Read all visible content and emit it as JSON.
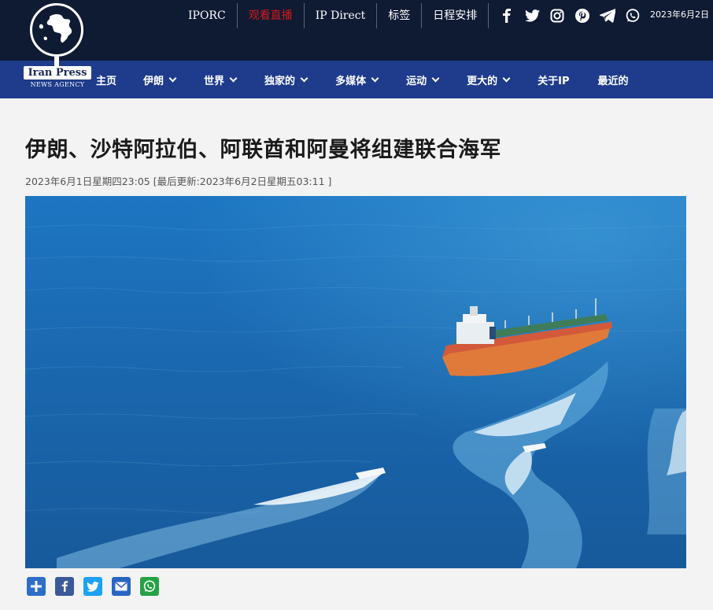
{
  "brand": {
    "name": "Iran Press",
    "subtitle": "NEWS AGENCY"
  },
  "top_links": [
    {
      "label": "IPORC"
    },
    {
      "label": "观看直播"
    },
    {
      "label": "IP Direct"
    },
    {
      "label": "标签"
    },
    {
      "label": "日程安排"
    }
  ],
  "social_icons": [
    "facebook-icon",
    "twitter-icon",
    "instagram-icon",
    "pinterest-icon",
    "telegram-icon",
    "whatsapp-icon"
  ],
  "top_date": "2023年6月2日",
  "nav": [
    {
      "label": "主页",
      "dropdown": false
    },
    {
      "label": "伊朗",
      "dropdown": true
    },
    {
      "label": "世界",
      "dropdown": true
    },
    {
      "label": "独家的",
      "dropdown": true
    },
    {
      "label": "多媒体",
      "dropdown": true
    },
    {
      "label": "运动",
      "dropdown": true
    },
    {
      "label": "更大的",
      "dropdown": true
    },
    {
      "label": "关于IP",
      "dropdown": false
    },
    {
      "label": "最近的",
      "dropdown": false
    }
  ],
  "article": {
    "title": "伊朗、沙特阿拉伯、阿联酋和阿曼将组建联合海军",
    "meta": "2023年6月1日星期四23:05 [最后更新:2023年6月2日星期五03:11 ]"
  },
  "share_buttons": [
    "share-plus-icon",
    "facebook-icon",
    "twitter-icon",
    "email-icon",
    "whatsapp-icon"
  ],
  "colors": {
    "topbar": "#0f1a33",
    "navbar": "#1e3b8c",
    "live_link": "#d01a1a",
    "sea": "#1b69b3"
  }
}
